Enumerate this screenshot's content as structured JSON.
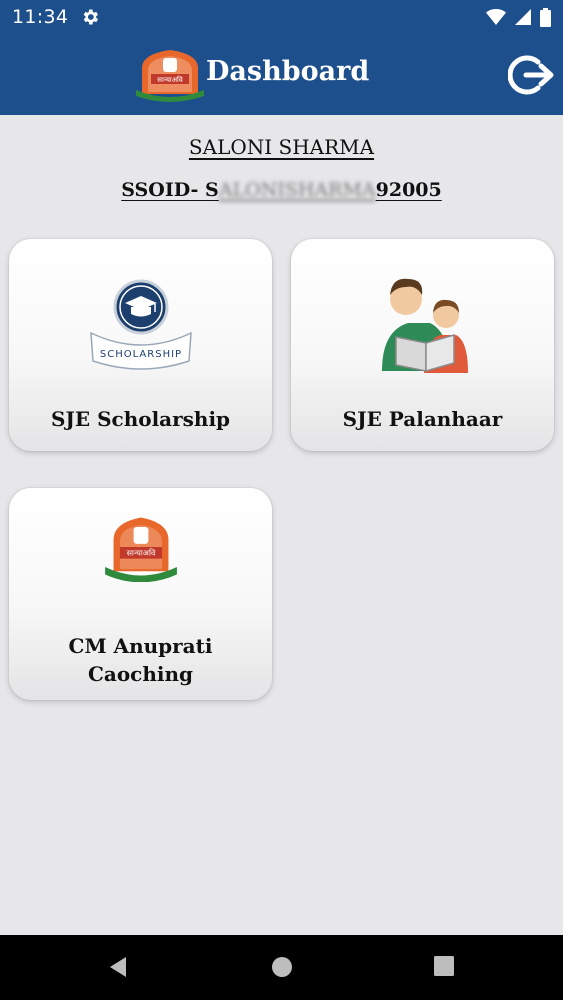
{
  "status_bar": {
    "time": "11:34",
    "icons": [
      "gear-icon",
      "wifi-icon",
      "signal-icon",
      "battery-icon"
    ]
  },
  "app_bar": {
    "title": "Dashboard",
    "logo": "department-emblem-logo",
    "logout_icon": "logout-icon",
    "color": "#1d4f8c"
  },
  "user": {
    "name": "SALONI SHARMA",
    "ssoid_label": "SSOID- ",
    "ssoid_visible_start": "S",
    "ssoid_obscured": "ALONISHARMA",
    "ssoid_visible_end": "92005"
  },
  "cards": [
    {
      "label": "SJE Scholarship",
      "icon": "scholarship-icon"
    },
    {
      "label": "SJE Palanhaar",
      "icon": "parent-child-reading-icon"
    },
    {
      "label_line1": "CM Anuprati",
      "label_line2": "Caoching",
      "icon": "department-emblem-icon"
    }
  ],
  "nav_bar": {
    "icons": [
      "back-icon",
      "home-icon",
      "recents-icon"
    ]
  },
  "colors": {
    "primary": "#1d4f8c",
    "background": "#e7e6e8",
    "emblem_orange": "#e8672a",
    "emblem_green": "#2f8a3c"
  }
}
